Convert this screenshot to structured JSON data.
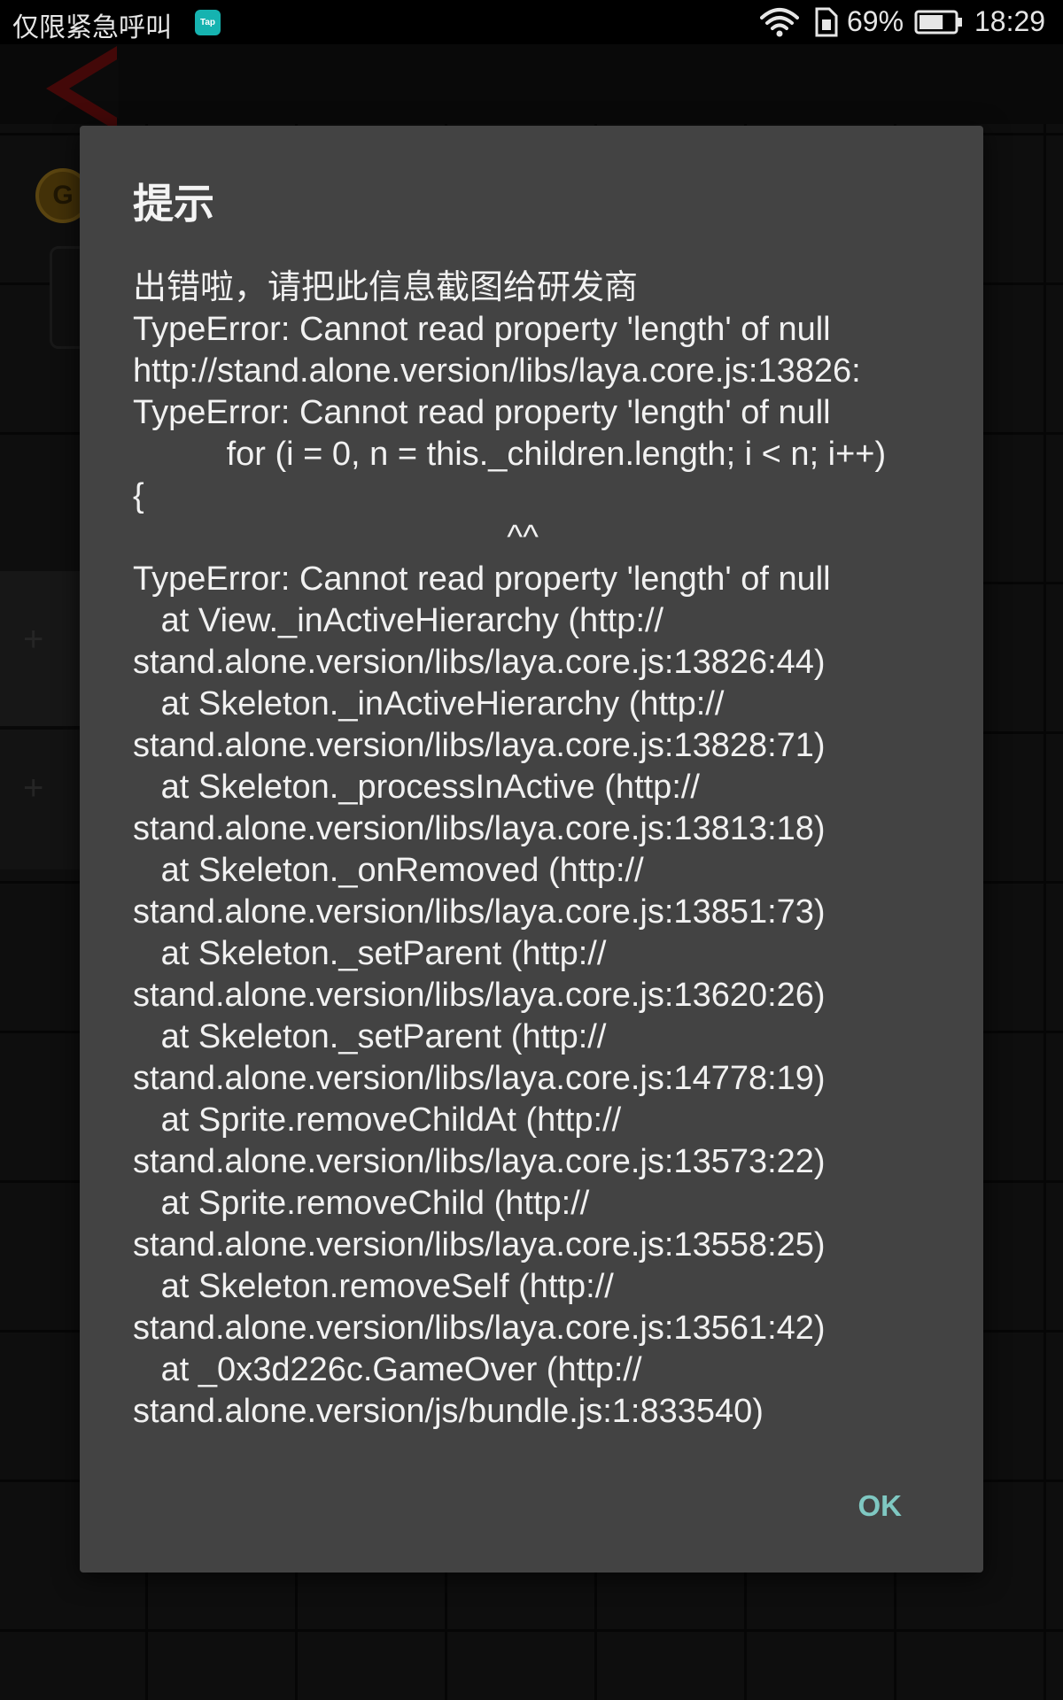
{
  "status_bar": {
    "carrier_text": "仅限紧急呼叫",
    "app_badge": "Tap",
    "battery_percent": "69%",
    "time": "18:29",
    "icons": [
      "tap-app-icon",
      "wifi-icon",
      "sim-icon",
      "battery-icon"
    ],
    "battery_level": 0.69
  },
  "background": {
    "coin_letter": "G"
  },
  "dialog": {
    "title": "提示",
    "message": "出错啦，请把此信息截图给研发商\nTypeError: Cannot read property 'length' of null\nhttp://stand.alone.version/libs/laya.core.js:13826:\nTypeError: Cannot read property 'length' of null\n          for (i = 0, n = this._children.length; i < n; i++)\n{\n                                        ^^\nTypeError: Cannot read property 'length' of null\n   at View._inActiveHierarchy (http://\nstand.alone.version/libs/laya.core.js:13826:44)\n   at Skeleton._inActiveHierarchy (http://\nstand.alone.version/libs/laya.core.js:13828:71)\n   at Skeleton._processInActive (http://\nstand.alone.version/libs/laya.core.js:13813:18)\n   at Skeleton._onRemoved (http://\nstand.alone.version/libs/laya.core.js:13851:73)\n   at Skeleton._setParent (http://\nstand.alone.version/libs/laya.core.js:13620:26)\n   at Skeleton._setParent (http://\nstand.alone.version/libs/laya.core.js:14778:19)\n   at Sprite.removeChildAt (http://\nstand.alone.version/libs/laya.core.js:13573:22)\n   at Sprite.removeChild (http://\nstand.alone.version/libs/laya.core.js:13558:25)\n   at Skeleton.removeSelf (http://\nstand.alone.version/libs/laya.core.js:13561:42)\n   at _0x3d226c.GameOver (http://\nstand.alone.version/js/bundle.js:1:833540)",
    "ok_label": "OK"
  },
  "colors": {
    "dialog_bg": "#434343",
    "accent": "#7fc8c2",
    "status_bar_bg": "#000000"
  }
}
